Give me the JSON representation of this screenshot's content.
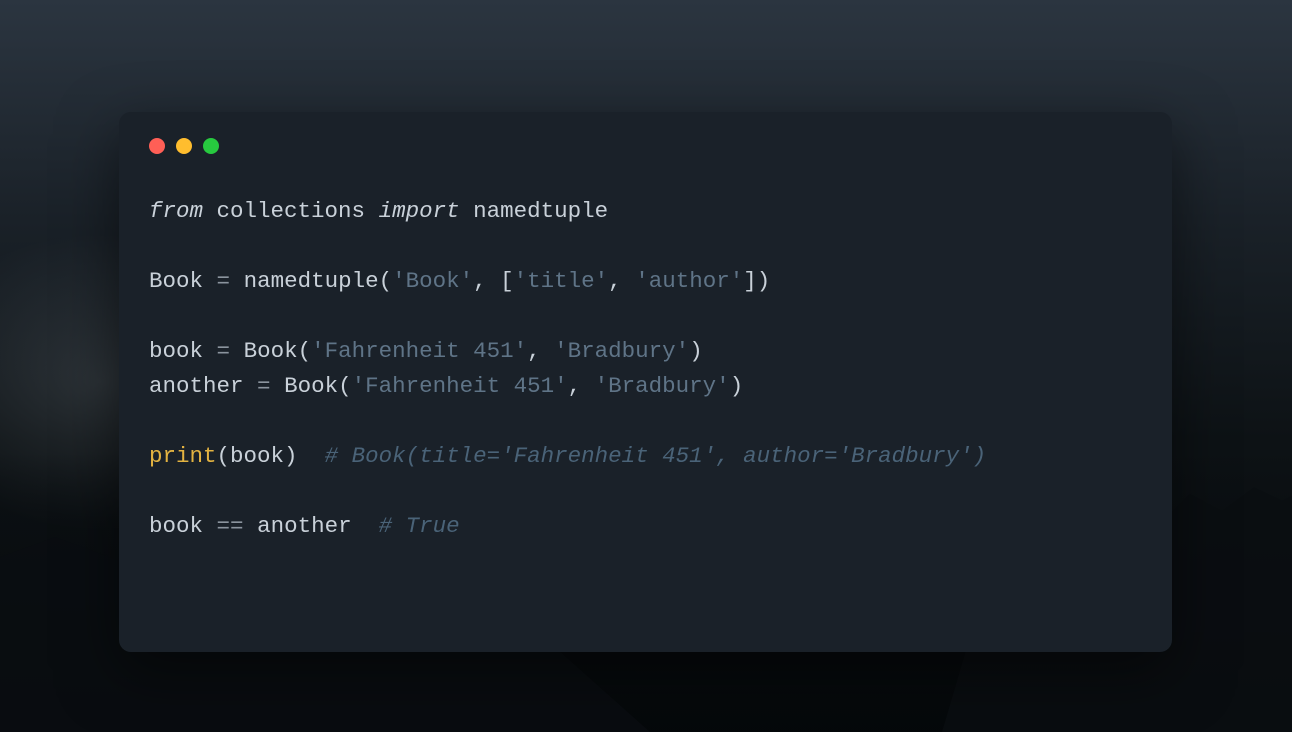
{
  "traffic_lights": {
    "red": "#ff5f56",
    "yellow": "#ffbd2e",
    "green": "#27c93f"
  },
  "code": {
    "lines": [
      {
        "tokens": [
          {
            "cls": "tok-keyword",
            "text": "from"
          },
          {
            "cls": "tok-plain",
            "text": " "
          },
          {
            "cls": "tok-module",
            "text": "collections"
          },
          {
            "cls": "tok-plain",
            "text": " "
          },
          {
            "cls": "tok-keyword",
            "text": "import"
          },
          {
            "cls": "tok-plain",
            "text": " "
          },
          {
            "cls": "tok-name",
            "text": "namedtuple"
          }
        ]
      },
      {
        "tokens": []
      },
      {
        "tokens": [
          {
            "cls": "tok-var",
            "text": "Book"
          },
          {
            "cls": "tok-plain",
            "text": " "
          },
          {
            "cls": "tok-op",
            "text": "="
          },
          {
            "cls": "tok-plain",
            "text": " "
          },
          {
            "cls": "tok-func",
            "text": "namedtuple"
          },
          {
            "cls": "tok-paren",
            "text": "("
          },
          {
            "cls": "tok-string",
            "text": "'Book'"
          },
          {
            "cls": "tok-plain",
            "text": ", "
          },
          {
            "cls": "tok-bracket",
            "text": "["
          },
          {
            "cls": "tok-string",
            "text": "'title'"
          },
          {
            "cls": "tok-plain",
            "text": ", "
          },
          {
            "cls": "tok-string",
            "text": "'author'"
          },
          {
            "cls": "tok-bracket",
            "text": "]"
          },
          {
            "cls": "tok-paren",
            "text": ")"
          }
        ]
      },
      {
        "tokens": []
      },
      {
        "tokens": [
          {
            "cls": "tok-var",
            "text": "book"
          },
          {
            "cls": "tok-plain",
            "text": " "
          },
          {
            "cls": "tok-op",
            "text": "="
          },
          {
            "cls": "tok-plain",
            "text": " "
          },
          {
            "cls": "tok-func",
            "text": "Book"
          },
          {
            "cls": "tok-paren",
            "text": "("
          },
          {
            "cls": "tok-string",
            "text": "'Fahrenheit 451'"
          },
          {
            "cls": "tok-plain",
            "text": ", "
          },
          {
            "cls": "tok-string",
            "text": "'Bradbury'"
          },
          {
            "cls": "tok-paren",
            "text": ")"
          }
        ]
      },
      {
        "tokens": [
          {
            "cls": "tok-var",
            "text": "another"
          },
          {
            "cls": "tok-plain",
            "text": " "
          },
          {
            "cls": "tok-op",
            "text": "="
          },
          {
            "cls": "tok-plain",
            "text": " "
          },
          {
            "cls": "tok-func",
            "text": "Book"
          },
          {
            "cls": "tok-paren",
            "text": "("
          },
          {
            "cls": "tok-string",
            "text": "'Fahrenheit 451'"
          },
          {
            "cls": "tok-plain",
            "text": ", "
          },
          {
            "cls": "tok-string",
            "text": "'Bradbury'"
          },
          {
            "cls": "tok-paren",
            "text": ")"
          }
        ]
      },
      {
        "tokens": []
      },
      {
        "tokens": [
          {
            "cls": "tok-builtin",
            "text": "print"
          },
          {
            "cls": "tok-paren",
            "text": "("
          },
          {
            "cls": "tok-var",
            "text": "book"
          },
          {
            "cls": "tok-paren",
            "text": ")"
          },
          {
            "cls": "tok-plain",
            "text": "  "
          },
          {
            "cls": "tok-comment",
            "text": "# Book(title='Fahrenheit 451', author='Bradbury')"
          }
        ]
      },
      {
        "tokens": []
      },
      {
        "tokens": [
          {
            "cls": "tok-var",
            "text": "book"
          },
          {
            "cls": "tok-plain",
            "text": " "
          },
          {
            "cls": "tok-op",
            "text": "=="
          },
          {
            "cls": "tok-plain",
            "text": " "
          },
          {
            "cls": "tok-var",
            "text": "another"
          },
          {
            "cls": "tok-plain",
            "text": "  "
          },
          {
            "cls": "tok-comment",
            "text": "# True"
          }
        ]
      }
    ]
  }
}
